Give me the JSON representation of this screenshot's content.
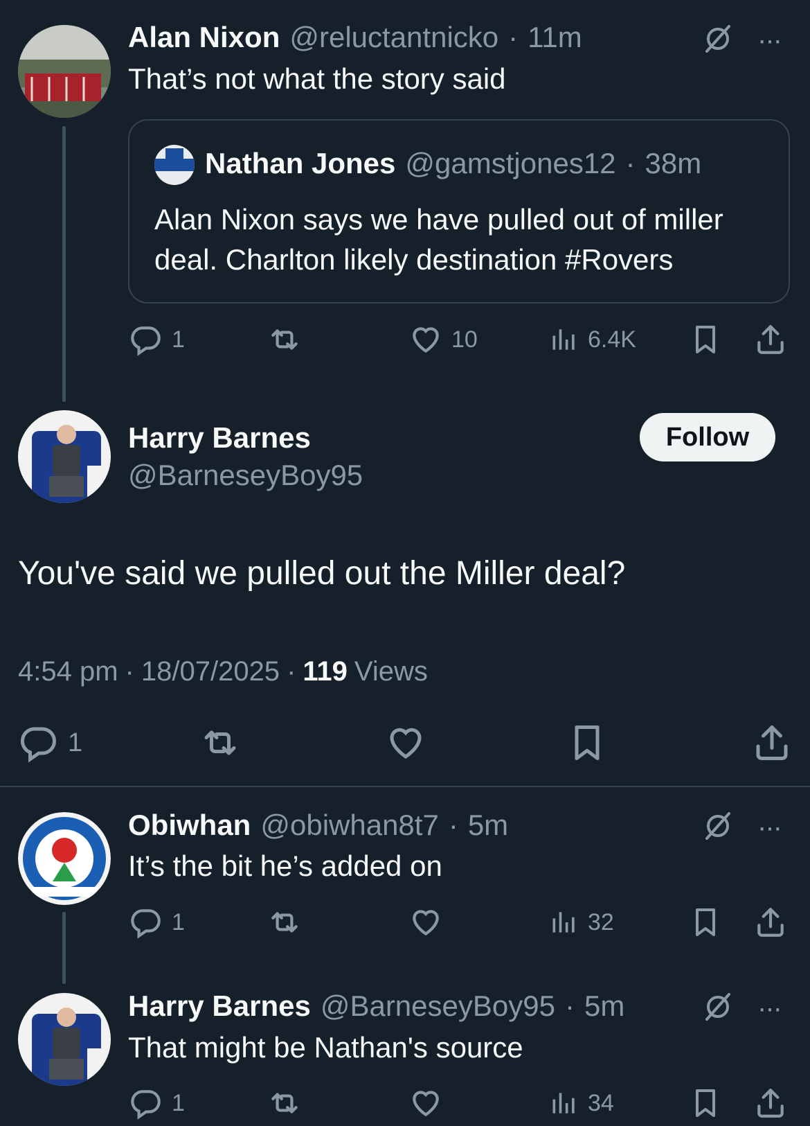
{
  "tweet1": {
    "name": "Alan Nixon",
    "handle": "@reluctantnicko",
    "sep": "·",
    "time": "11m",
    "text": "That’s not what the story said",
    "quote": {
      "name": "Nathan Jones",
      "handle": "@gamstjones12",
      "sep": "·",
      "time": "38m",
      "line1": "Alan Nixon says we have pulled out of miller",
      "line2": "deal. Charlton likely destination #Rovers"
    },
    "replies": "1",
    "likes": "10",
    "views": "6.4K"
  },
  "main": {
    "name": "Harry Barnes",
    "handle": "@BarneseyBoy95",
    "follow_label": "Follow",
    "text": "You've said we pulled out the Miller deal?",
    "time": "4:54 pm",
    "date": "18/07/2025",
    "sep": "·",
    "views_count": "119",
    "views_label": "Views",
    "replies": "1"
  },
  "reply1": {
    "name": "Obiwhan",
    "handle": "@obiwhan8t7",
    "sep": "·",
    "time": "5m",
    "text": "It’s the bit he’s added on",
    "replies": "1",
    "views": "32"
  },
  "reply2": {
    "name": "Harry Barnes",
    "handle": "@BarneseyBoy95",
    "sep": "·",
    "time": "5m",
    "text": "That might be Nathan's source",
    "replies": "1",
    "views": "34"
  },
  "menu_label": "···",
  "colors": {
    "background": "#15202b",
    "secondary_text": "#8b98a5",
    "border": "#38444d"
  }
}
